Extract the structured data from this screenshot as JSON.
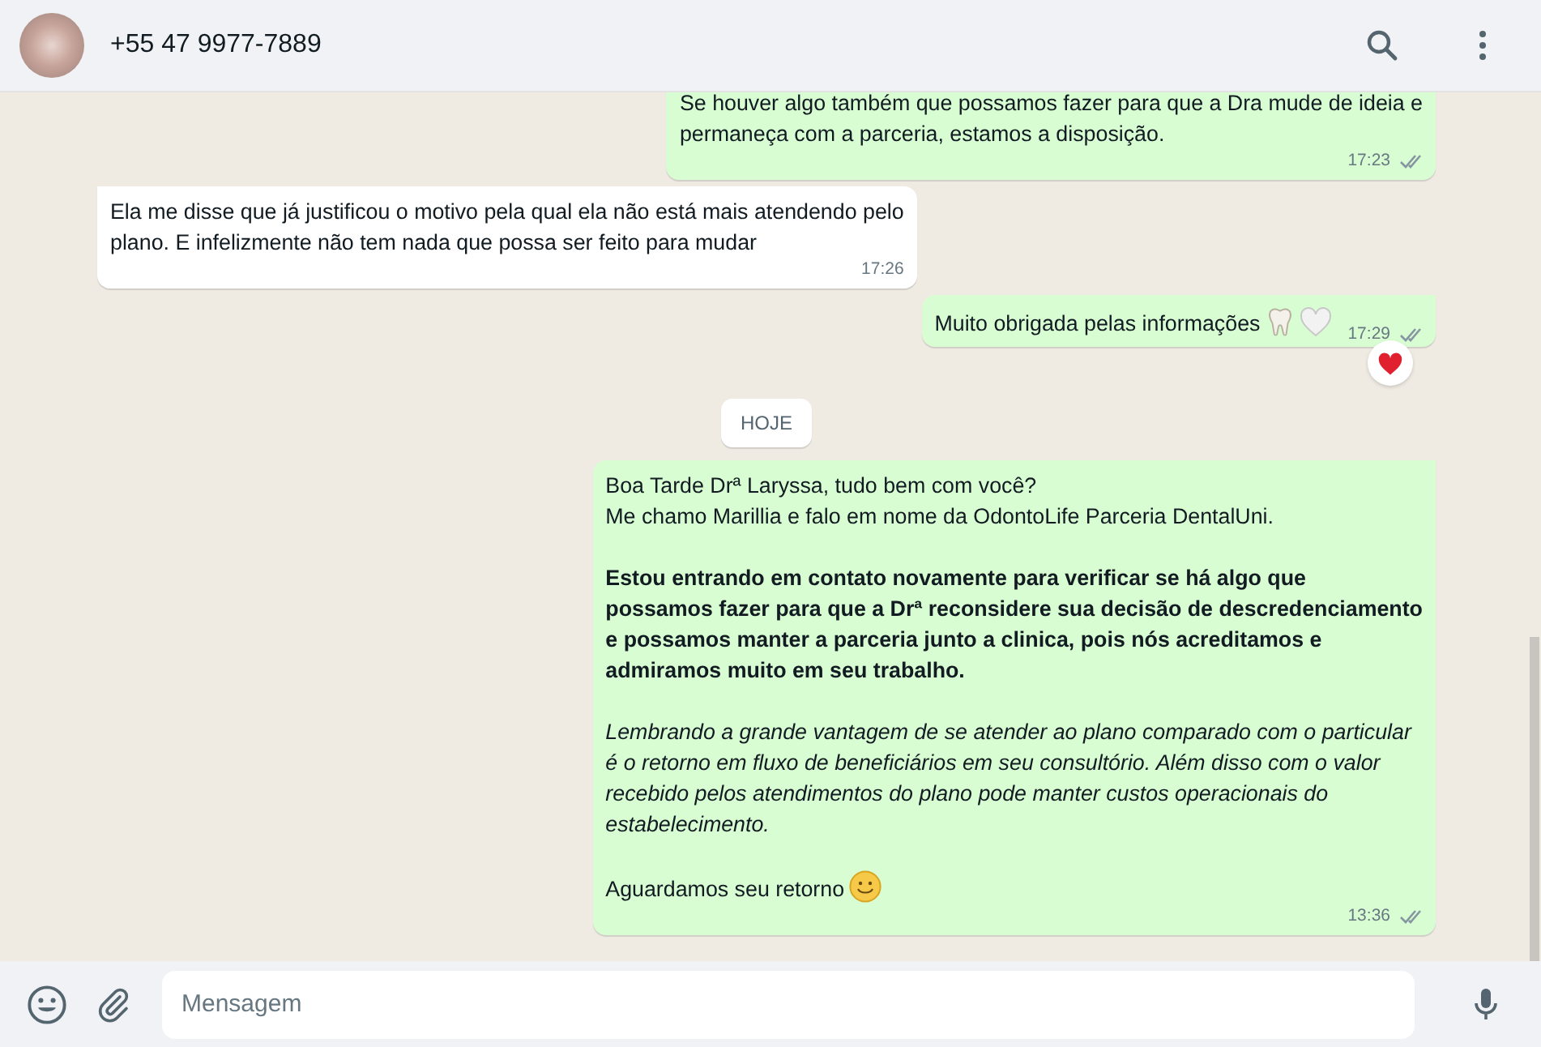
{
  "header": {
    "contact": "+55 47 9977-7889"
  },
  "messages": [
    {
      "kind": "message",
      "outgoing": true,
      "tail": false,
      "paragraphs": [
        {
          "kind": "plain",
          "text": "Se houver algo também que possamos fazer para que a Dra mude de ideia e\npermaneça com a parceria, estamos a disposição."
        }
      ],
      "time": "17:23",
      "read": false
    },
    {
      "kind": "message",
      "outgoing": false,
      "tail": true,
      "paragraphs": [
        {
          "kind": "plain",
          "text": "Ela me disse que já justificou o motivo pela qual ela não está mais atendendo pelo\nplano. E infelizmente não tem nada que possa ser feito para mudar"
        }
      ],
      "time": "17:26"
    },
    {
      "kind": "message",
      "outgoing": true,
      "tail": true,
      "paragraphs": [
        {
          "kind": "plain",
          "text": "Muito obrigada pelas informações",
          "emoji": [
            {
              "kind": "tooth"
            },
            {
              "kind": "heart"
            }
          ]
        }
      ],
      "time": "17:29",
      "read": false,
      "reaction": {
        "kind": "heart"
      }
    },
    {
      "kind": "date",
      "text": "HOJE"
    },
    {
      "kind": "message",
      "outgoing": true,
      "tail": true,
      "paragraphs": [
        {
          "kind": "plain",
          "text": "Boa Tarde Drª Laryssa, tudo bem com você?\nMe chamo Marillia e falo em nome da OdontoLife Parceria DentalUni."
        },
        {
          "kind": "bold",
          "text": "Estou entrando em contato novamente para verificar se há algo que\npossamos fazer para que a Drª reconsidere sua decisão de descredenciamento\ne possamos manter a parceria junto a clinica, pois nós acreditamos e\nadmiramos muito em seu trabalho."
        },
        {
          "kind": "italic",
          "text": "Lembrando a grande vantagem de se atender ao plano comparado com o particular\né o retorno em fluxo de beneficiários em seu consultório. Além disso com o valor\nrecebido pelos atendimentos do plano pode manter custos operacionais do\nestabelecimento."
        },
        {
          "kind": "plain",
          "text": "Aguardamos seu retorno",
          "emoji": [
            {
              "kind": "smile"
            }
          ]
        }
      ],
      "time": "13:36",
      "read": false
    }
  ],
  "composer": {
    "placeholder": "Mensagem"
  }
}
